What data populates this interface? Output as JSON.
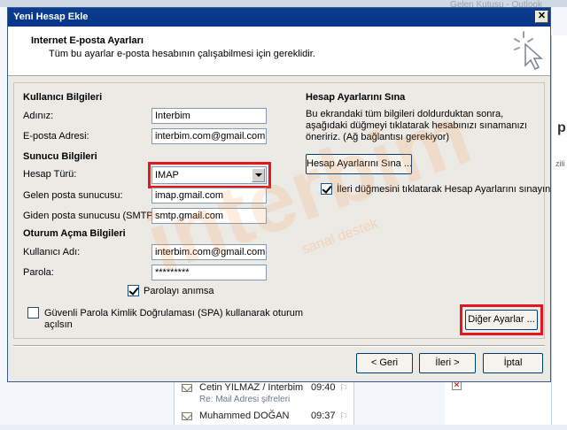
{
  "background": {
    "top_right_text": "Gelen Kutusu - Outlook",
    "right_pane_glyph": "p",
    "right_pane_small": "zili",
    "messages": [
      {
        "from": "Cetin YILMAZ / Interbim",
        "time": "09:40",
        "subject": "Re: Mail Adresi şifreleri"
      },
      {
        "from": "Muhammed DOĞAN",
        "time": "09:37",
        "subject": ""
      }
    ]
  },
  "dialog": {
    "title": "Yeni Hesap Ekle",
    "close_glyph": "✕",
    "header_title": "Internet E-posta Ayarları",
    "header_subtitle": "Tüm bu ayarlar e-posta hesabının çalışabilmesi için gereklidir.",
    "user_section": "Kullanıcı Bilgileri",
    "name_label": "Adınız:",
    "name_value": "Interbim",
    "email_label": "E-posta Adresi:",
    "email_value": "interbim.com@gmail.com",
    "server_section": "Sunucu Bilgileri",
    "account_type_label": "Hesap Türü:",
    "account_type_value": "IMAP",
    "incoming_label": "Gelen posta sunucusu:",
    "incoming_value": "imap.gmail.com",
    "outgoing_label": "Giden posta sunucusu (SMTP):",
    "outgoing_value": "smtp.gmail.com",
    "logon_section": "Oturum Açma Bilgileri",
    "username_label": "Kullanıcı Adı:",
    "username_value": "interbim.com@gmail.com",
    "password_label": "Parola:",
    "password_value": "*********",
    "remember_label": "Parolayı anımsa",
    "remember_checked": true,
    "spa_label_line1": "Güvenli Parola Kimlik Doğrulaması (SPA) kullanarak oturum",
    "spa_label_line2": "açılsın",
    "spa_checked": false,
    "test_section": "Hesap Ayarlarını Sına",
    "test_desc": "Bu ekrandaki tüm bilgileri doldurduktan sonra, aşağıdaki düğmeyi tıklatarak hesabınızı sınamanızı öneririz. (Ağ bağlantısı gerekiyor)",
    "test_button": "Hesap Ayarlarını Sına ...",
    "auto_test_label": "İleri düğmesini tıklatarak Hesap Ayarlarını sınayın",
    "auto_test_checked": true,
    "more_settings_button": "Diğer Ayarlar ...",
    "back_button": "< Geri",
    "next_button": "İleri >",
    "cancel_button": "İptal"
  },
  "watermark": {
    "text": "interbim",
    "subtext": "sanal destek"
  },
  "colors": {
    "highlight": "#e5161d",
    "titlebar": "#0a3d8f"
  }
}
